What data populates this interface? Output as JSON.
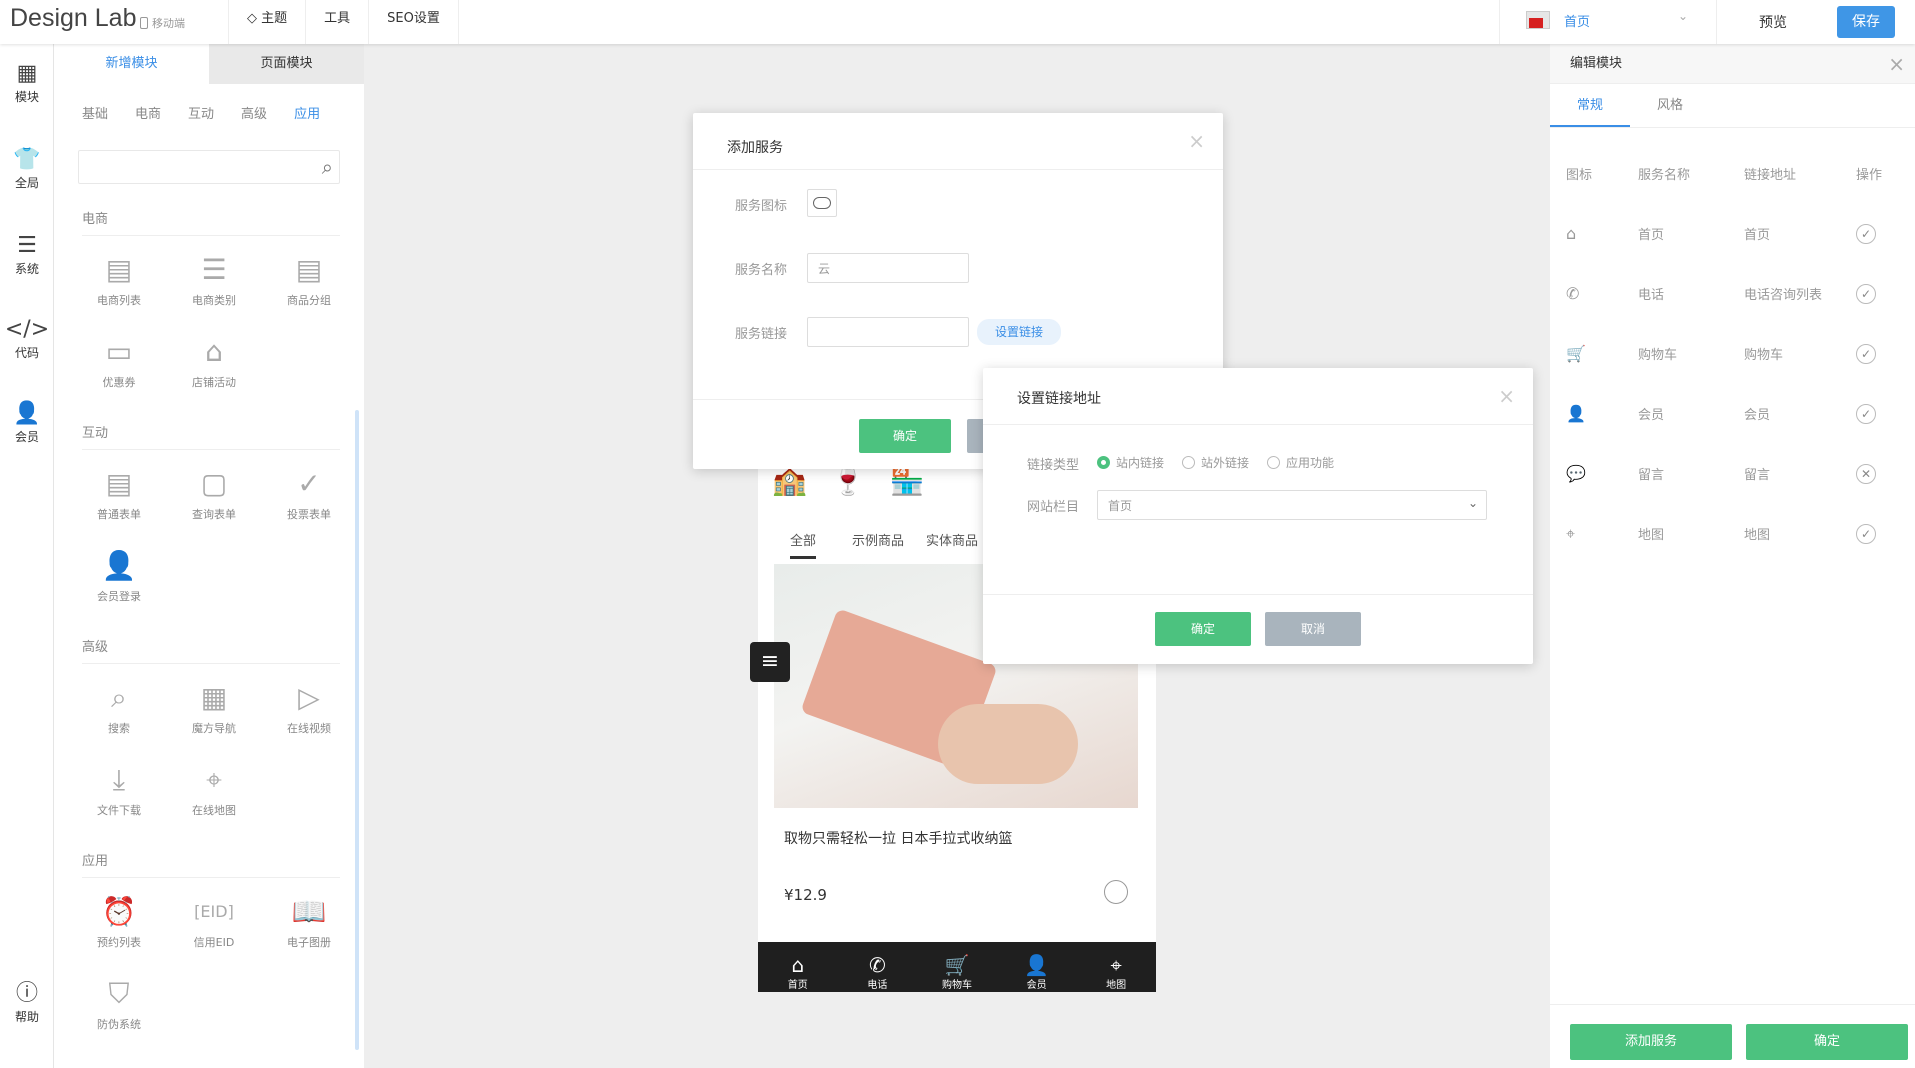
{
  "topbar": {
    "logo": "Design Lab",
    "mobile_label": "移动端",
    "nav": [
      "主题",
      "工具",
      "SEO设置"
    ],
    "page_select": "首页",
    "preview_label": "预览",
    "save_label": "保存"
  },
  "leftbar": {
    "items": [
      {
        "label": "模块",
        "icon": "grid-icon"
      },
      {
        "label": "全局",
        "icon": "shirt-icon"
      },
      {
        "label": "系统",
        "icon": "document-icon"
      },
      {
        "label": "代码",
        "icon": "code-icon"
      },
      {
        "label": "会员",
        "icon": "user-icon"
      }
    ],
    "help_label": "帮助"
  },
  "panel": {
    "tabs": [
      "新增模块",
      "页面模块"
    ],
    "subtabs": [
      "基础",
      "电商",
      "互动",
      "高级",
      "应用"
    ],
    "active_subtab": "应用",
    "sections": [
      {
        "title": "电商",
        "items": [
          "电商列表",
          "电商类别",
          "商品分组",
          "优惠券",
          "店铺活动"
        ]
      },
      {
        "title": "互动",
        "items": [
          "普通表单",
          "查询表单",
          "投票表单",
          "会员登录"
        ]
      },
      {
        "title": "高级",
        "items": [
          "搜索",
          "魔方导航",
          "在线视频",
          "文件下载",
          "在线地图"
        ]
      },
      {
        "title": "应用",
        "items": [
          "预约列表",
          "信用EID",
          "电子图册",
          "防伪系统"
        ]
      }
    ]
  },
  "phone": {
    "tabs": [
      "全部",
      "示例商品",
      "实体商品"
    ],
    "product_title": "取物只需轻松一拉 日本手拉式收纳篮",
    "price": "¥12.9",
    "bottom_nav": [
      "首页",
      "电话",
      "购物车",
      "会员",
      "地图"
    ]
  },
  "dialog_add": {
    "title": "添加服务",
    "icon_label": "服务图标",
    "name_label": "服务名称",
    "name_value": "云",
    "link_label": "服务链接",
    "set_link_label": "设置链接",
    "confirm_label": "确定"
  },
  "dialog_link": {
    "title": "设置链接地址",
    "type_label": "链接类型",
    "options": [
      "站内链接",
      "站外链接",
      "应用功能"
    ],
    "selected_option": "站内链接",
    "column_label": "网站栏目",
    "column_value": "首页",
    "confirm_label": "确定",
    "cancel_label": "取消"
  },
  "rightpanel": {
    "title": "编辑模块",
    "tabs": [
      "常规",
      "风格"
    ],
    "headers": [
      "图标",
      "服务名称",
      "链接地址",
      "操作"
    ],
    "rows": [
      {
        "icon": "home-icon",
        "name": "首页",
        "link": "首页",
        "state": "check"
      },
      {
        "icon": "phone-icon",
        "name": "电话",
        "link": "电话咨询列表",
        "state": "check"
      },
      {
        "icon": "cart-icon",
        "name": "购物车",
        "link": "购物车",
        "state": "check"
      },
      {
        "icon": "user-icon",
        "name": "会员",
        "link": "会员",
        "state": "check"
      },
      {
        "icon": "message-icon",
        "name": "留言",
        "link": "留言",
        "state": "cross"
      },
      {
        "icon": "location-icon",
        "name": "地图",
        "link": "地图",
        "state": "check"
      }
    ],
    "add_service_label": "添加服务",
    "confirm_label": "确定"
  },
  "colors": {
    "accent": "#3a8ee6",
    "green": "#4cc27f",
    "gray_button": "#a9b4bd"
  }
}
